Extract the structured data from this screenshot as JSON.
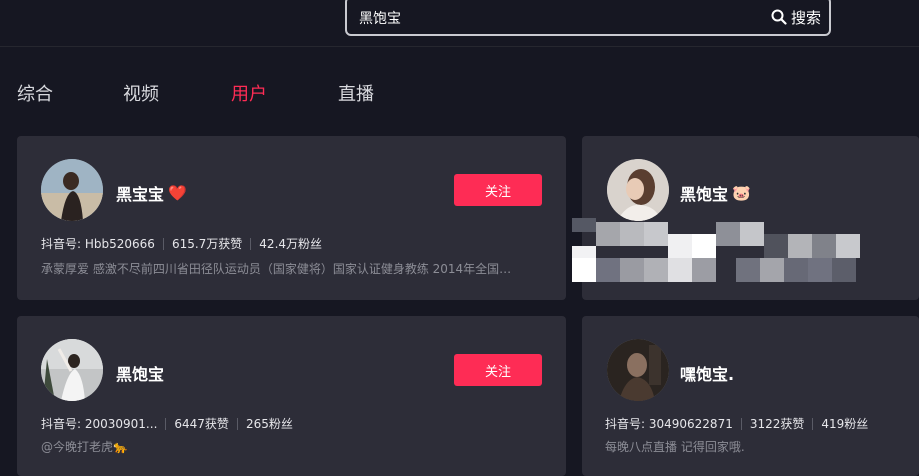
{
  "search": {
    "value": "黑饱宝",
    "button_label": "搜索"
  },
  "tabs": [
    {
      "label": "综合"
    },
    {
      "label": "视频"
    },
    {
      "label": "用户"
    },
    {
      "label": "直播"
    }
  ],
  "active_tab": "用户",
  "colors": {
    "accent": "#fe2c55",
    "background": "#161722",
    "card": "#2d2d38"
  },
  "users": [
    {
      "name": "黑宝宝",
      "emoji": "❤️",
      "follow_label": "关注",
      "stats": [
        "抖音号: Hbb520666",
        "615.7万获赞",
        "42.4万粉丝"
      ],
      "desc": "承蒙厚爱 感激不尽前四川省田径队运动员（国家健将）国家认证健身教练 2014年全国…"
    },
    {
      "name": "黑饱宝",
      "emoji": "🐷",
      "blurred": true
    },
    {
      "name": "黑饱宝",
      "follow_label": "关注",
      "stats": [
        "抖音号: 20030901...",
        "6447获赞",
        "265粉丝"
      ],
      "desc": "@今晚打老虎🐆"
    },
    {
      "name": "嘿饱宝.",
      "stats": [
        "抖音号: 30490622871",
        "3122获赞",
        "419粉丝"
      ],
      "desc": "每晚八点直播 记得回家哦."
    }
  ]
}
